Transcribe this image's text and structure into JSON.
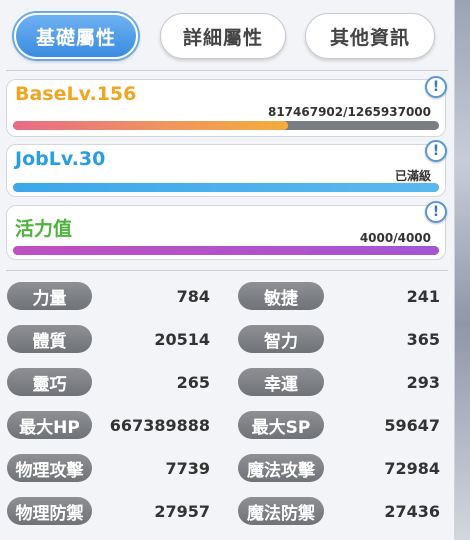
{
  "tabs": [
    {
      "label": "基礎屬性",
      "active": true
    },
    {
      "label": "詳細屬性",
      "active": false
    },
    {
      "label": "其他資訊",
      "active": false
    }
  ],
  "info_icon_glyph": "!",
  "levels": {
    "base": {
      "title": "BaseLv.156",
      "detail": "817467902/1265937000",
      "progress": 0.6457,
      "color": "#f2b233"
    },
    "job": {
      "title": "JobLv.30",
      "detail": "已滿級",
      "progress": 1.0,
      "color": "#36a6e8"
    },
    "vitality": {
      "title": "活力值",
      "detail": "4000/4000",
      "progress": 1.0,
      "color": "#55bb44"
    }
  },
  "stats": {
    "str": {
      "label": "力量",
      "value": "784"
    },
    "agi": {
      "label": "敏捷",
      "value": "241"
    },
    "vit": {
      "label": "體質",
      "value": "20514"
    },
    "int": {
      "label": "智力",
      "value": "365"
    },
    "dex": {
      "label": "靈巧",
      "value": "265"
    },
    "luk": {
      "label": "幸運",
      "value": "293"
    },
    "maxhp": {
      "label": "最大HP",
      "value": "667389888"
    },
    "maxsp": {
      "label": "最大SP",
      "value": "59647"
    },
    "patk": {
      "label": "物理攻擊",
      "value": "7739"
    },
    "matk": {
      "label": "魔法攻擊",
      "value": "72984"
    },
    "pdef": {
      "label": "物理防禦",
      "value": "27957"
    },
    "mdef": {
      "label": "魔法防禦",
      "value": "27436"
    }
  }
}
